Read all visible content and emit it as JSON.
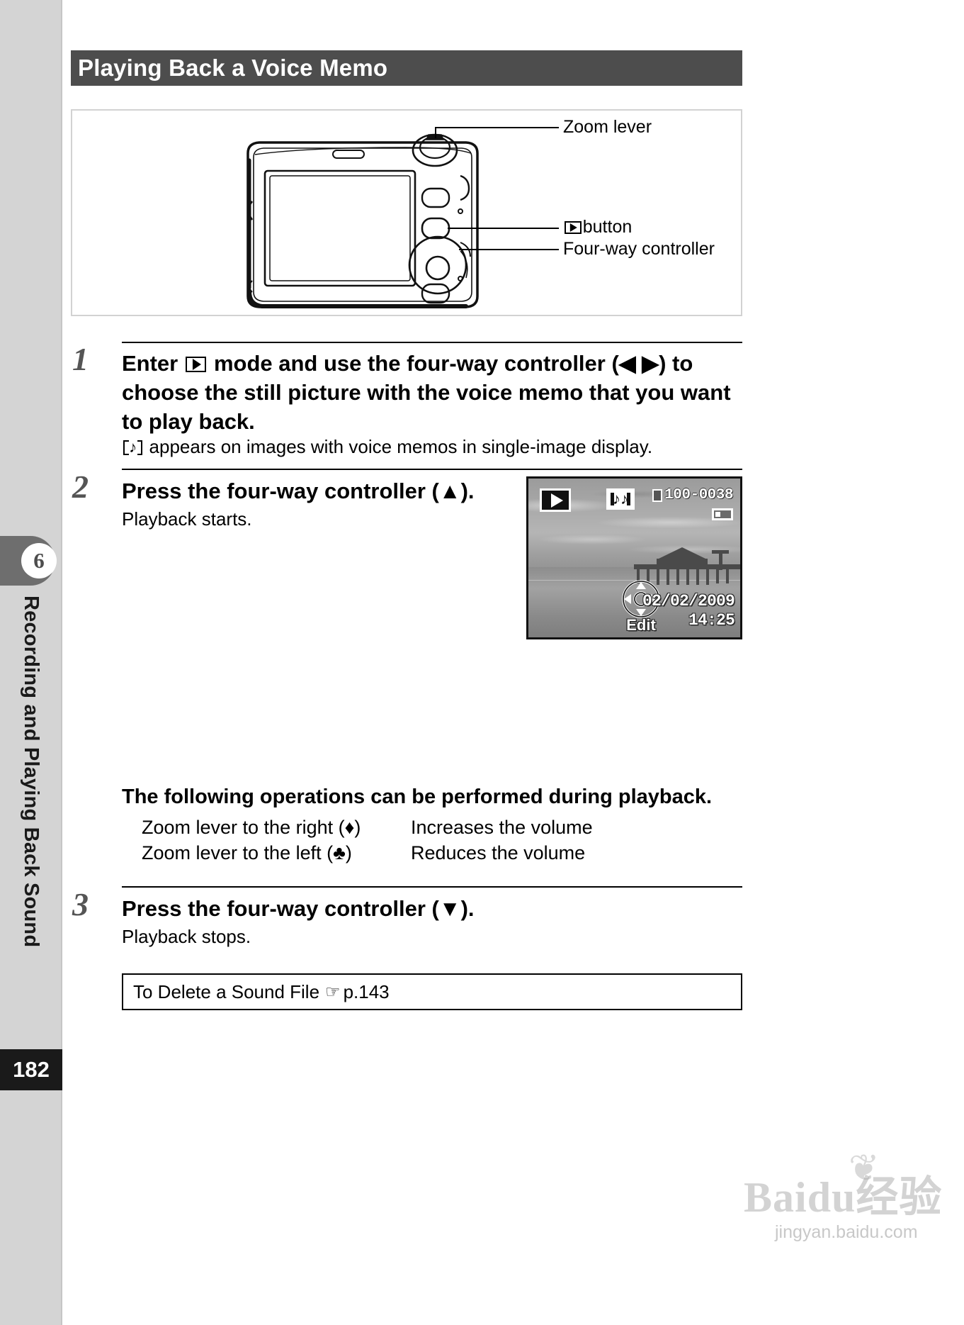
{
  "sidebar": {
    "chapter_number": "6",
    "chapter_title": "Recording and Playing Back Sound",
    "page_number": "182"
  },
  "header": {
    "title": "Playing Back a Voice Memo"
  },
  "figure": {
    "callouts": [
      {
        "label": "Zoom lever",
        "name": "zoom-lever-callout"
      },
      {
        "label": "button",
        "name": "playback-button-callout",
        "icon": "playback-icon"
      },
      {
        "label": "Four-way controller",
        "name": "four-way-controller-callout"
      }
    ]
  },
  "steps": [
    {
      "number": "1",
      "heading_part1": "Enter",
      "heading_part2": "mode and use the four-way controller (",
      "heading_arrows": "◀ ▶",
      "heading_part3": ") to choose the still picture with the voice memo that you want to play back.",
      "sub": "appears on images with voice memos in single-image display."
    },
    {
      "number": "2",
      "heading": "Press the four-way controller (▲).",
      "sub": "Playback starts."
    },
    {
      "number": "3",
      "heading": "Press the four-way controller (▼).",
      "sub": "Playback stops."
    }
  ],
  "lcd": {
    "playback_icon": "playback-icon",
    "memo_icon": "voice-memo-icon",
    "note_glyph": "♪♪",
    "file_number": "100-0038",
    "date": "02/02/2009",
    "time": "14:25",
    "edit_label": "Edit",
    "battery_icon": "battery-icon",
    "card_icon": "memory-card-icon"
  },
  "operations": {
    "heading": "The following operations can be performed during playback.",
    "rows": [
      {
        "left": "Zoom lever to the right (",
        "symbol": "♦",
        "left_close": ")",
        "right": "Increases the volume"
      },
      {
        "left": "Zoom lever to the left (",
        "symbol": "♣",
        "left_close": ")",
        "right": "Reduces the volume"
      }
    ]
  },
  "note": {
    "text": "To Delete a Sound File",
    "hand": "☞",
    "reference": "p.143"
  },
  "watermark": {
    "main": "Baidu经验",
    "sub": "jingyan.baidu.com",
    "paw": "❦"
  },
  "colors": {
    "heading_bar": "#4d4d4d",
    "sidebar": "#d4d4d4",
    "chapter_tab": "#6e6e6e",
    "page_block": "#1a1a1a"
  }
}
